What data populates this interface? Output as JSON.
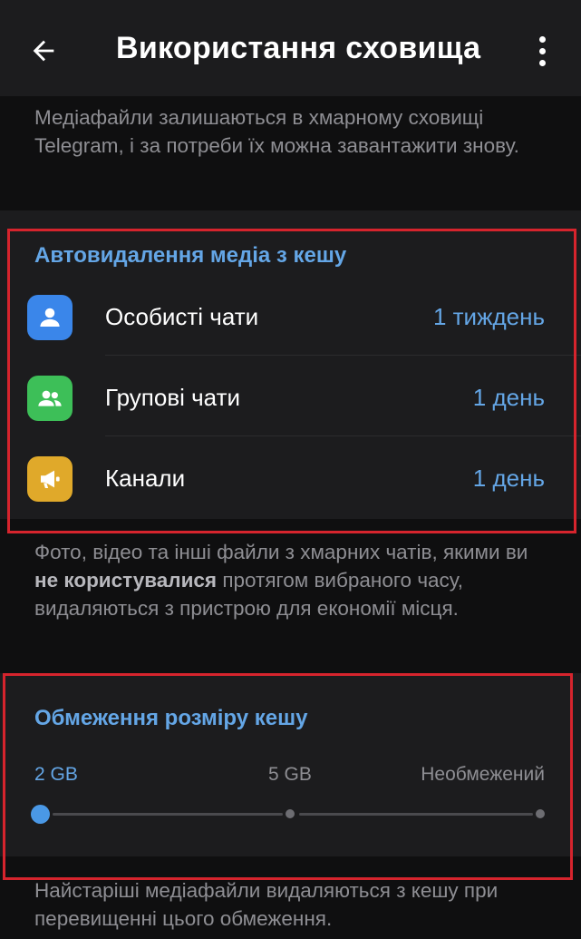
{
  "header": {
    "title": "Використання сховища",
    "back_icon": "arrow-left-icon",
    "menu_icon": "more-vertical-icon"
  },
  "info_top": {
    "text": "Медіафайли залишаються в хмарному сховищі Telegram, і за потреби їх можна завантажити знову."
  },
  "auto_delete": {
    "title": "Автовидалення медіа з кешу",
    "rows": [
      {
        "label": "Особисті чати",
        "value": "1 тиждень",
        "icon": "user-icon",
        "color": "#3a86ea"
      },
      {
        "label": "Групові чати",
        "value": "1 день",
        "icon": "group-icon",
        "color": "#3dbf58"
      },
      {
        "label": "Канали",
        "value": "1 день",
        "icon": "megaphone-icon",
        "color": "#e0a92a"
      }
    ]
  },
  "info_mid": {
    "text_before": "Фото, відео та інші файли з хмарних чатів, якими ви ",
    "text_bold": "не користувалися",
    "text_after": " протягом вибраного часу, видаляються з пристрою для економії місця."
  },
  "cache_size": {
    "title": "Обмеження розміру кешу",
    "options": [
      "2 GB",
      "5 GB",
      "Необмежений"
    ],
    "selected": "2 GB"
  },
  "info_bottom": {
    "text": "Найстаріші медіафайли видаляються з кешу при перевищенні цього обмеження."
  },
  "colors": {
    "accent": "#64a6e6",
    "highlight_border": "#d6242d"
  }
}
